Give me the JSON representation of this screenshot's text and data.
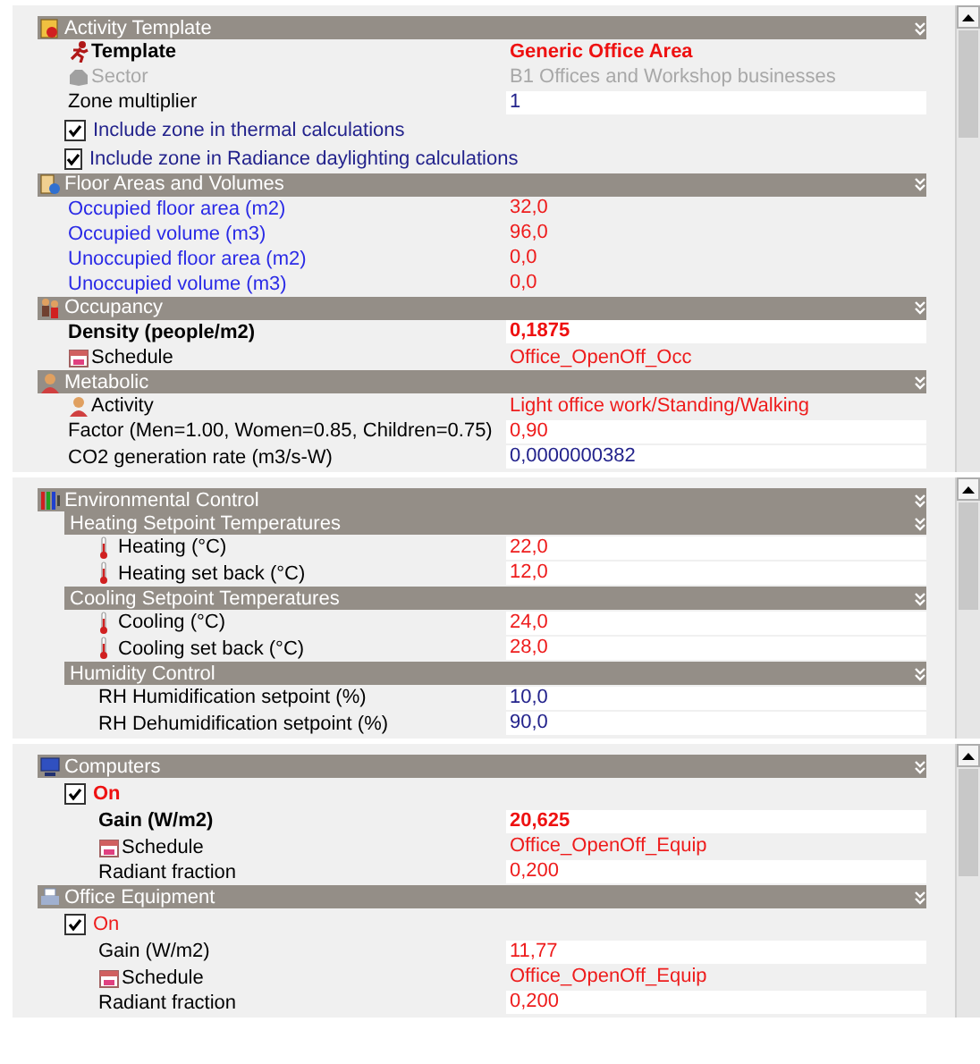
{
  "panels": [
    {
      "sections": [
        {
          "title": "Activity Template",
          "rows": [
            {
              "kind": "title-text",
              "label": "Template",
              "value": "Generic Office Area",
              "color": "#ee1111"
            },
            {
              "kind": "text",
              "label": "Sector",
              "value": "B1 Offices and Workshop businesses",
              "color": "#a8a8a8",
              "disabled": true
            },
            {
              "kind": "input",
              "label": "Zone multiplier",
              "value": "1",
              "color": "#23238c"
            },
            {
              "kind": "checkbox",
              "label": "Include zone in thermal calculations",
              "color": "#23238c",
              "checked": true
            },
            {
              "kind": "checkbox",
              "label": "Include zone in Radiance daylighting calculations",
              "color": "#23238c",
              "checked": true
            }
          ]
        },
        {
          "title": "Floor Areas and Volumes",
          "rows": [
            {
              "kind": "link",
              "label": "Occupied floor area (m2)",
              "value": "32,0",
              "color": "#ee1c1c"
            },
            {
              "kind": "link",
              "label": "Occupied volume (m3)",
              "value": "96,0",
              "color": "#ee1c1c"
            },
            {
              "kind": "link",
              "label": "Unoccupied floor area (m2)",
              "value": "0,0",
              "color": "#ee1c1c"
            },
            {
              "kind": "link",
              "label": "Unoccupied volume (m3)",
              "value": "0,0",
              "color": "#ee1c1c"
            }
          ]
        },
        {
          "title": "Occupancy",
          "rows": [
            {
              "kind": "title-input",
              "label": "Density (people/m2)",
              "value": "0,1875",
              "color": "#ee1111"
            },
            {
              "kind": "text",
              "label": "Schedule",
              "value": "Office_OpenOff_Occ",
              "color": "#ee1c1c"
            }
          ]
        },
        {
          "title": "Metabolic",
          "rows": [
            {
              "kind": "text",
              "label": "Activity",
              "value": "Light office work/Standing/Walking",
              "color": "#ee1c1c"
            },
            {
              "kind": "input",
              "label": "Factor (Men=1.00, Women=0.85, Children=0.75)",
              "value": "0,90",
              "color": "#ee1c1c"
            },
            {
              "kind": "input",
              "label": "CO2 generation rate (m3/s-W)",
              "value": "0,0000000382",
              "color": "#23238c"
            }
          ]
        }
      ]
    },
    {
      "sections": [
        {
          "title": "Environmental Control",
          "subsections": [
            {
              "title": "Heating Setpoint Temperatures",
              "rows": [
                {
                  "kind": "input",
                  "label": "Heating (°C)",
                  "value": "22,0",
                  "color": "#ee1c1c"
                },
                {
                  "kind": "input",
                  "label": "Heating set back (°C)",
                  "value": "12,0",
                  "color": "#ee1c1c"
                }
              ]
            },
            {
              "title": "Cooling Setpoint Temperatures",
              "rows": [
                {
                  "kind": "input",
                  "label": "Cooling (°C)",
                  "value": "24,0",
                  "color": "#ee1c1c"
                },
                {
                  "kind": "input",
                  "label": "Cooling set back (°C)",
                  "value": "28,0",
                  "color": "#ee1c1c"
                }
              ]
            },
            {
              "title": "Humidity Control",
              "rows": [
                {
                  "kind": "input",
                  "label": "RH Humidification setpoint (%)",
                  "value": "10,0",
                  "color": "#23238c"
                },
                {
                  "kind": "input",
                  "label": "RH Dehumidification setpoint (%)",
                  "value": "90,0",
                  "color": "#23238c"
                }
              ]
            }
          ]
        }
      ]
    },
    {
      "sections": [
        {
          "title": "Computers",
          "rows": [
            {
              "kind": "title-checkbox",
              "label": "On",
              "color": "#ee1111",
              "checked": true,
              "children": [
                {
                  "kind": "title-input",
                  "label": "Gain (W/m2)",
                  "value": "20,625",
                  "color": "#ee1111"
                },
                {
                  "kind": "text",
                  "label": "Schedule",
                  "value": "Office_OpenOff_Equip",
                  "color": "#ee1c1c"
                },
                {
                  "kind": "input",
                  "label": "Radiant fraction",
                  "value": "0,200",
                  "color": "#ee1c1c"
                }
              ]
            }
          ]
        },
        {
          "title": "Office Equipment",
          "rows": [
            {
              "kind": "checkbox",
              "label": "On",
              "color": "#ee1c1c",
              "checked": true,
              "children": [
                {
                  "kind": "input",
                  "label": "Gain (W/m2)",
                  "value": "11,77",
                  "color": "#ee1c1c"
                },
                {
                  "kind": "text",
                  "label": "Schedule",
                  "value": "Office_OpenOff_Equip",
                  "color": "#ee1c1c"
                },
                {
                  "kind": "input",
                  "label": "Radiant fraction",
                  "value": "0,200",
                  "color": "#ee1c1c"
                }
              ]
            }
          ]
        }
      ]
    }
  ]
}
